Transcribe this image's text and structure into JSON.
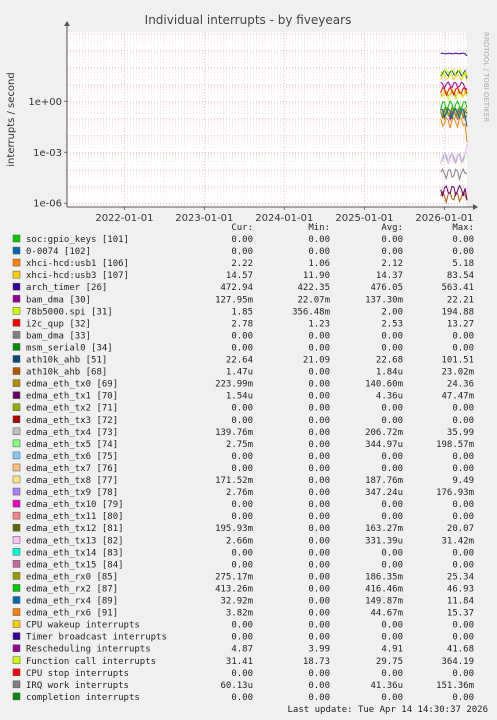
{
  "chart_data": {
    "type": "line",
    "title": "Individual interrupts - by fiveyears",
    "ylabel": "interrupts / second",
    "yscale": "log",
    "ylim": [
      6e-07,
      12000
    ],
    "y_ticks": [
      "1e-06",
      "1e-03",
      "1e+00"
    ],
    "x_ticks": [
      "2022-01-01",
      "2023-01-01",
      "2024-01-01",
      "2025-01-01",
      "2026-01-01"
    ],
    "grid": true,
    "side_label": "RRDTOOL / TOBI OETIKER",
    "columns": [
      "Cur:",
      "Min:",
      "Avg:",
      "Max:"
    ],
    "series": [
      {
        "name": "soc:gpio_keys [101]",
        "color": "#00cc00",
        "cur": "0.00",
        "min": "0.00",
        "avg": "0.00",
        "max": "0.00"
      },
      {
        "name": "0-0074 [102]",
        "color": "#0066b3",
        "cur": "0.00",
        "min": "0.00",
        "avg": "0.00",
        "max": "0.00"
      },
      {
        "name": "xhci-hcd:usb1 [106]",
        "color": "#ff8000",
        "cur": "2.22",
        "min": "1.06",
        "avg": "2.12",
        "max": "5.18"
      },
      {
        "name": "xhci-hcd:usb3 [107]",
        "color": "#ffcc00",
        "cur": "14.57",
        "min": "11.90",
        "avg": "14.37",
        "max": "83.54"
      },
      {
        "name": "arch_timer [26]",
        "color": "#330099",
        "cur": "472.94",
        "min": "422.35",
        "avg": "476.05",
        "max": "563.41"
      },
      {
        "name": "bam_dma [30]",
        "color": "#990099",
        "cur": "127.95m",
        "min": "22.07m",
        "avg": "137.30m",
        "max": "22.21"
      },
      {
        "name": "78b5000.spi [31]",
        "color": "#ccff00",
        "cur": "1.85",
        "min": "356.48m",
        "avg": "2.00",
        "max": "194.88"
      },
      {
        "name": "i2c_qup [32]",
        "color": "#ff0000",
        "cur": "2.78",
        "min": "1.23",
        "avg": "2.53",
        "max": "13.27"
      },
      {
        "name": "bam_dma [33]",
        "color": "#808080",
        "cur": "0.00",
        "min": "0.00",
        "avg": "0.00",
        "max": "0.00"
      },
      {
        "name": "msm_serial0 [34]",
        "color": "#008f00",
        "cur": "0.00",
        "min": "0.00",
        "avg": "0.00",
        "max": "0.00"
      },
      {
        "name": "ath10k_ahb [51]",
        "color": "#00487d",
        "cur": "22.64",
        "min": "21.09",
        "avg": "22.68",
        "max": "101.51"
      },
      {
        "name": "ath10k_ahb [68]",
        "color": "#b35a00",
        "cur": "1.47u",
        "min": "0.00",
        "avg": "1.84u",
        "max": "23.02m"
      },
      {
        "name": "edma_eth_tx0 [69]",
        "color": "#b38f00",
        "cur": "223.99m",
        "min": "0.00",
        "avg": "140.60m",
        "max": "24.36"
      },
      {
        "name": "edma_eth_tx1 [70]",
        "color": "#6b006b",
        "cur": "1.54u",
        "min": "0.00",
        "avg": "4.36u",
        "max": "47.47m"
      },
      {
        "name": "edma_eth_tx2 [71]",
        "color": "#8fb300",
        "cur": "0.00",
        "min": "0.00",
        "avg": "0.00",
        "max": "0.00"
      },
      {
        "name": "edma_eth_tx3 [72]",
        "color": "#b30000",
        "cur": "0.00",
        "min": "0.00",
        "avg": "0.00",
        "max": "0.00"
      },
      {
        "name": "edma_eth_tx4 [73]",
        "color": "#bebebe",
        "cur": "139.76m",
        "min": "0.00",
        "avg": "206.72m",
        "max": "35.99"
      },
      {
        "name": "edma_eth_tx5 [74]",
        "color": "#80ff80",
        "cur": "2.75m",
        "min": "0.00",
        "avg": "344.97u",
        "max": "198.57m"
      },
      {
        "name": "edma_eth_tx6 [75]",
        "color": "#80c9ff",
        "cur": "0.00",
        "min": "0.00",
        "avg": "0.00",
        "max": "0.00"
      },
      {
        "name": "edma_eth_tx7 [76]",
        "color": "#ffc080",
        "cur": "0.00",
        "min": "0.00",
        "avg": "0.00",
        "max": "0.00"
      },
      {
        "name": "edma_eth_tx8 [77]",
        "color": "#ffe680",
        "cur": "171.52m",
        "min": "0.00",
        "avg": "187.76m",
        "max": "9.49"
      },
      {
        "name": "edma_eth_tx9 [78]",
        "color": "#aa80ff",
        "cur": "2.76m",
        "min": "0.00",
        "avg": "347.24u",
        "max": "176.93m"
      },
      {
        "name": "edma_eth_tx10 [79]",
        "color": "#ee00cc",
        "cur": "0.00",
        "min": "0.00",
        "avg": "0.00",
        "max": "0.00"
      },
      {
        "name": "edma_eth_tx11 [80]",
        "color": "#ff8080",
        "cur": "0.00",
        "min": "0.00",
        "avg": "0.00",
        "max": "0.00"
      },
      {
        "name": "edma_eth_tx12 [81]",
        "color": "#666600",
        "cur": "195.93m",
        "min": "0.00",
        "avg": "163.27m",
        "max": "20.07"
      },
      {
        "name": "edma_eth_tx13 [82]",
        "color": "#ffbfff",
        "cur": "2.66m",
        "min": "0.00",
        "avg": "331.39u",
        "max": "31.42m"
      },
      {
        "name": "edma_eth_tx14 [83]",
        "color": "#00ffcc",
        "cur": "0.00",
        "min": "0.00",
        "avg": "0.00",
        "max": "0.00"
      },
      {
        "name": "edma_eth_tx15 [84]",
        "color": "#cc6699",
        "cur": "0.00",
        "min": "0.00",
        "avg": "0.00",
        "max": "0.00"
      },
      {
        "name": "edma_eth_rx0 [85]",
        "color": "#999900",
        "cur": "275.17m",
        "min": "0.00",
        "avg": "186.35m",
        "max": "25.34"
      },
      {
        "name": "edma_eth_rx2 [87]",
        "color": "#00cc00",
        "cur": "413.26m",
        "min": "0.00",
        "avg": "416.46m",
        "max": "46.93"
      },
      {
        "name": "edma_eth_rx4 [89]",
        "color": "#0066b3",
        "cur": "32.92m",
        "min": "0.00",
        "avg": "149.87m",
        "max": "11.84"
      },
      {
        "name": "edma_eth_rx6 [91]",
        "color": "#ff8000",
        "cur": "3.82m",
        "min": "0.00",
        "avg": "44.67m",
        "max": "15.37"
      },
      {
        "name": "CPU wakeup interrupts",
        "color": "#ffcc00",
        "cur": "0.00",
        "min": "0.00",
        "avg": "0.00",
        "max": "0.00"
      },
      {
        "name": "Timer broadcast interrupts",
        "color": "#330099",
        "cur": "0.00",
        "min": "0.00",
        "avg": "0.00",
        "max": "0.00"
      },
      {
        "name": "Rescheduling interrupts",
        "color": "#990099",
        "cur": "4.87",
        "min": "3.99",
        "avg": "4.91",
        "max": "41.68"
      },
      {
        "name": "Function call interrupts",
        "color": "#ccff00",
        "cur": "31.41",
        "min": "18.73",
        "avg": "29.75",
        "max": "364.19"
      },
      {
        "name": "CPU stop interrupts",
        "color": "#ff0000",
        "cur": "0.00",
        "min": "0.00",
        "avg": "0.00",
        "max": "0.00"
      },
      {
        "name": "IRQ work interrupts",
        "color": "#808080",
        "cur": "60.13u",
        "min": "0.00",
        "avg": "41.36u",
        "max": "151.36m"
      },
      {
        "name": "completion interrupts",
        "color": "#008f00",
        "cur": "0.00",
        "min": "0.00",
        "avg": "0.00",
        "max": "0.00"
      }
    ],
    "last_update": "Last update: Tue Apr 14 14:30:37 2026"
  }
}
